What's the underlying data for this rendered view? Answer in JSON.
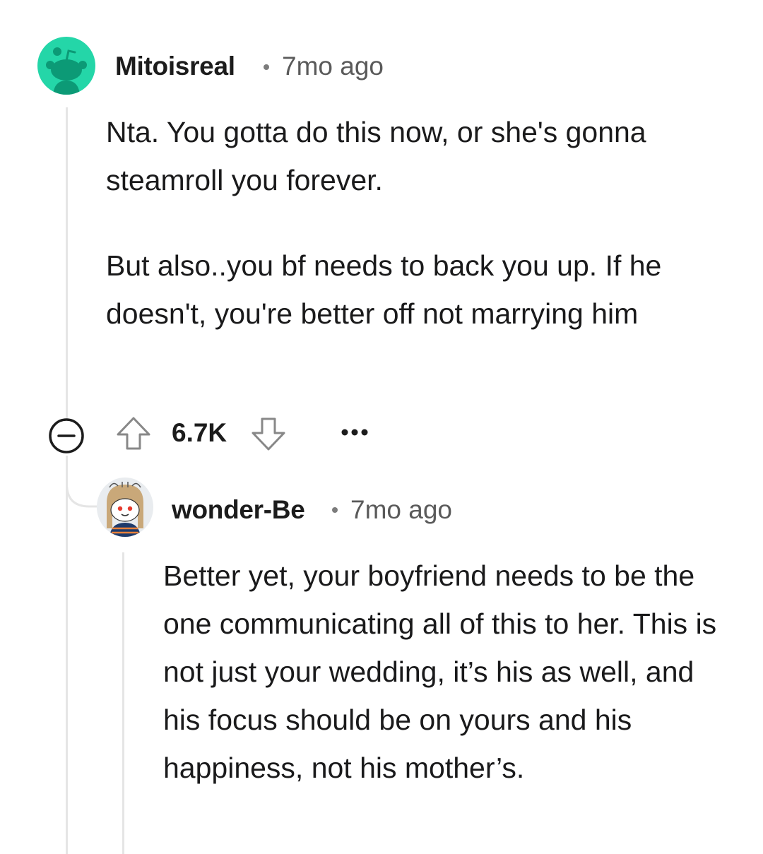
{
  "comment": {
    "username": "Mitoisreal",
    "time": "7mo ago",
    "paragraphs": [
      "Nta. You gotta do this now, or she's gonna steamroll you forever.",
      "But also..you bf needs to back you up. If he doesn't, you're better off not marrying him"
    ],
    "votes": "6.7K",
    "avatar_icon": "snoo-avatar-icon",
    "collapse_icon": "collapse-minus-icon",
    "upvote_icon": "upvote-arrow-icon",
    "downvote_icon": "downvote-arrow-icon",
    "more_icon": "more-options-icon",
    "avatar_color": "#24d6a8"
  },
  "reply": {
    "username": "wonder-Be",
    "time": "7mo ago",
    "text": "Better yet, your boyfriend needs to be the one communicating all of this to her. This is not just your wedding, it’s his as well, and his focus should be on yours and his happiness, not his mother’s.",
    "avatar_icon": "custom-snoo-avatar-icon"
  }
}
